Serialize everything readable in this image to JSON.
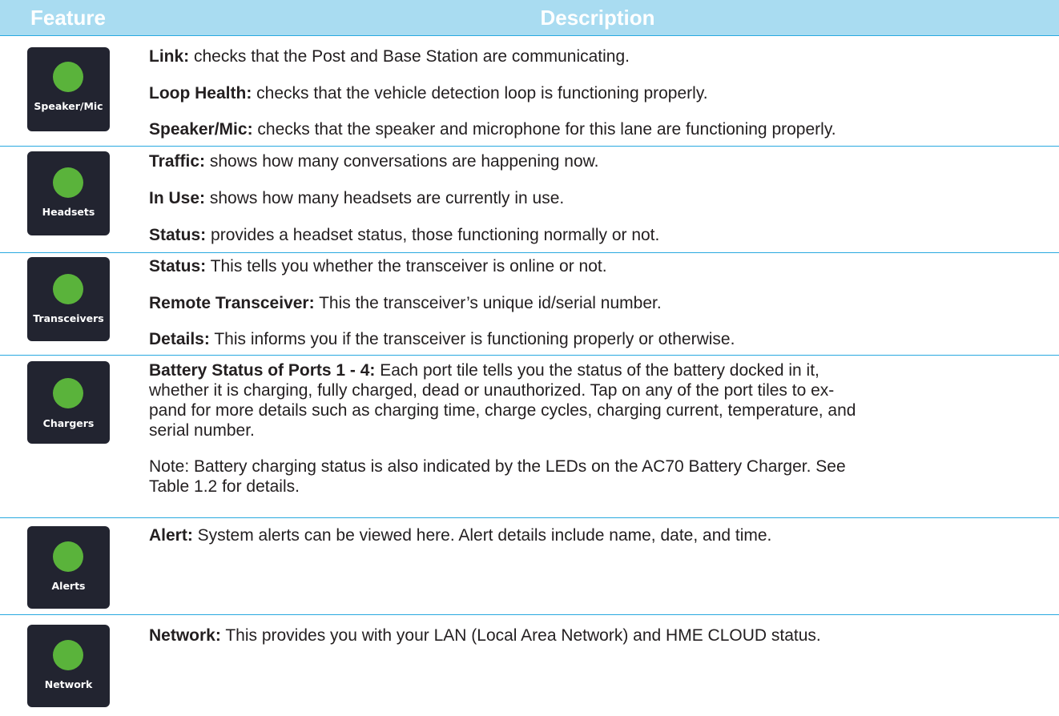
{
  "header": {
    "feature": "Feature",
    "description": "Description"
  },
  "rows": [
    {
      "tile": "Speaker/Mic",
      "items": [
        {
          "term": "Link:",
          "text": " checks that the Post and Base Station are communicating."
        },
        {
          "term": "Loop Health:",
          "text": " checks that the vehicle detection loop is functioning properly."
        },
        {
          "term": "Speaker/Mic:",
          "text": " checks that the speaker and microphone for this lane are functioning properly."
        }
      ]
    },
    {
      "tile": "Headsets",
      "items": [
        {
          "term": "Traffic:",
          "text": " shows how many conversations are happening now."
        },
        {
          "term": "In Use:",
          "text": " shows how many headsets are currently in use."
        },
        {
          "term": "Status:",
          "text": " provides a headset status, those functioning normally or not."
        }
      ]
    },
    {
      "tile": "Transceivers",
      "items": [
        {
          "term": "Status:",
          "text": " This tells you whether the transceiver is online or not."
        },
        {
          "term": "Remote Transceiver:",
          "text": " This the transceiver’s unique id/serial number."
        },
        {
          "term": "Details:",
          "text": " This informs you if the transceiver is functioning properly or otherwise."
        }
      ]
    },
    {
      "tile": "Chargers",
      "items": [
        {
          "term": "Battery Status of Ports 1 - 4:",
          "text": " Each port tile tells you the status of the battery docked in it,"
        },
        {
          "term": "",
          "text": "whether it is charging, fully charged, dead or unauthorized. Tap on any of the port tiles to ex-"
        },
        {
          "term": "",
          "text": "pand for more details such as charging time, charge cycles, charging current, temperature, and"
        },
        {
          "term": "",
          "text": "serial number."
        },
        {
          "term": "",
          "text": "Note: Battery charging status is also indicated by the LEDs on the AC70 Battery Charger. See"
        },
        {
          "term": "",
          "text": "Table 1.2 for details."
        }
      ]
    },
    {
      "tile": "Alerts",
      "items": [
        {
          "term": "Alert:",
          "text": " System alerts can be viewed here. Alert details include name, date, and time."
        }
      ]
    },
    {
      "tile": "Network",
      "items": [
        {
          "term": "Network:",
          "text": " This provides you with your LAN (Local Area Network) and HME CLOUD status."
        }
      ]
    }
  ]
}
